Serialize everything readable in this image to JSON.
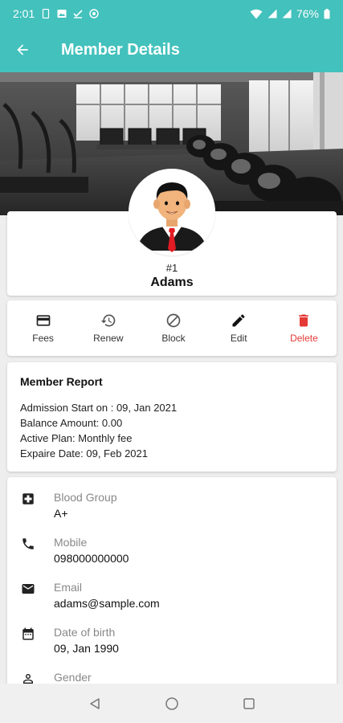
{
  "status_bar": {
    "time": "2:01",
    "battery": "76%"
  },
  "app_bar": {
    "title": "Member Details",
    "back_icon": "arrow-left-icon"
  },
  "profile": {
    "member_number": "#1",
    "name": "Adams"
  },
  "actions": [
    {
      "label": "Fees",
      "icon": "credit-card-icon"
    },
    {
      "label": "Renew",
      "icon": "history-icon"
    },
    {
      "label": "Block",
      "icon": "block-icon"
    },
    {
      "label": "Edit",
      "icon": "pencil-icon"
    },
    {
      "label": "Delete",
      "icon": "trash-icon"
    }
  ],
  "report": {
    "title": "Member Report",
    "lines": [
      "Admission Start on : 09, Jan 2021",
      "Balance Amount: 0.00",
      "Active Plan: Monthly fee",
      "Expaire Date: 09, Feb 2021"
    ]
  },
  "details": [
    {
      "label": "Blood Group",
      "value": "A+",
      "icon": "medical-cross-icon"
    },
    {
      "label": "Mobile",
      "value": "098000000000",
      "icon": "phone-icon"
    },
    {
      "label": "Email",
      "value": "adams@sample.com",
      "icon": "mail-icon"
    },
    {
      "label": "Date of birth",
      "value": "09, Jan 1990",
      "icon": "calendar-icon"
    },
    {
      "label": "Gender",
      "value": "",
      "icon": "person-icon"
    }
  ],
  "colors": {
    "accent": "#43c1bc",
    "delete": "#e53935"
  }
}
